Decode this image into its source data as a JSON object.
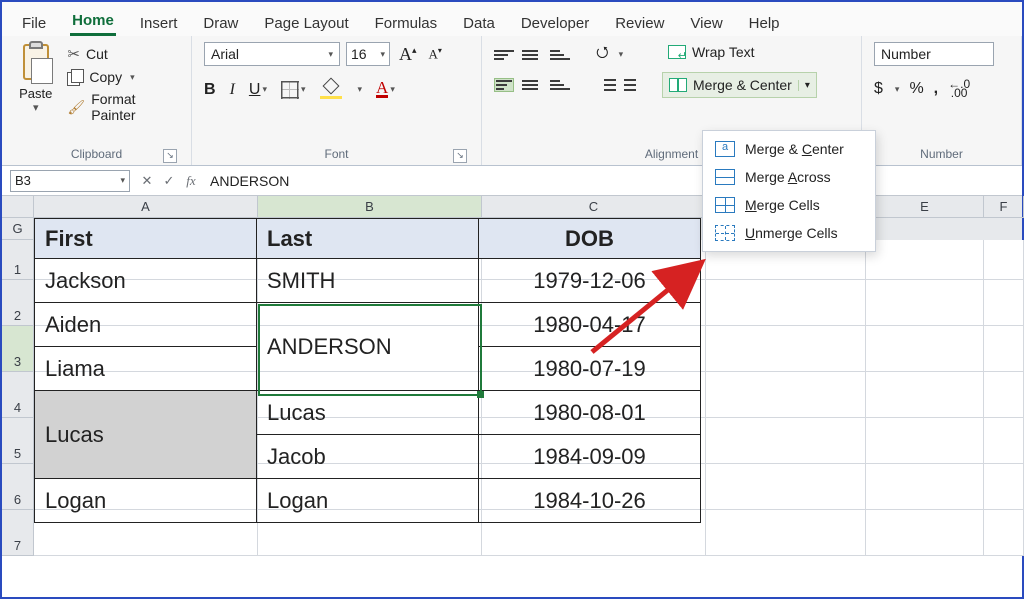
{
  "tabs": {
    "items": [
      "File",
      "Home",
      "Insert",
      "Draw",
      "Page Layout",
      "Formulas",
      "Data",
      "Developer",
      "Review",
      "View",
      "Help"
    ],
    "active": "Home"
  },
  "ribbon": {
    "clipboard": {
      "title": "Clipboard",
      "paste": "Paste",
      "cut": "Cut",
      "copy": "Copy",
      "format_painter": "Format Painter"
    },
    "font": {
      "title": "Font",
      "name": "Arial",
      "size": "16",
      "grow": "A",
      "shrink": "A",
      "bold": "B",
      "italic": "I",
      "underline": "U",
      "font_color_letter": "A"
    },
    "alignment": {
      "title": "Alignment",
      "wrap": "Wrap Text",
      "merge": "Merge & Center"
    },
    "number": {
      "title": "Number",
      "format": "Number",
      "currency": "$",
      "percent": "%",
      "comma": ",",
      "dec_inc": ".00",
      "dec_inc_arrow": "→.0"
    }
  },
  "merge_menu": {
    "center": "Merge & Center",
    "across": "Merge Across",
    "cells": "Merge Cells",
    "unmerge": "Unmerge Cells"
  },
  "formula_bar": {
    "name_box": "B3",
    "value": "ANDERSON"
  },
  "columns": [
    "A",
    "B",
    "C",
    "D",
    "E",
    "F",
    "G"
  ],
  "row_numbers": [
    "1",
    "2",
    "3",
    "4",
    "5",
    "6",
    "7"
  ],
  "chart_data": {
    "type": "table",
    "headers": [
      "First",
      "Last",
      "DOB"
    ],
    "rows": [
      {
        "first": "Jackson",
        "last": "SMITH",
        "dob": "1979-12-06"
      },
      {
        "first": "Aiden",
        "last": "ANDERSON",
        "dob": "1980-04-17",
        "last_merge_from_above": false,
        "last_merge_start": true
      },
      {
        "first": "Liama",
        "last": "ANDERSON",
        "dob": "1980-07-19",
        "last_merge_from_above": true
      },
      {
        "first": "Lucas",
        "last": "Lucas",
        "dob": "1980-08-01",
        "first_merge_start": true
      },
      {
        "first": "Lucas",
        "last": "Jacob",
        "dob": "1984-09-09",
        "first_merge_from_above": true
      },
      {
        "first": "Logan",
        "last": "Logan",
        "dob": "1984-10-26"
      }
    ],
    "active_cell": "B3",
    "merged_ranges": [
      "B3:B4",
      "A5:A6"
    ]
  }
}
